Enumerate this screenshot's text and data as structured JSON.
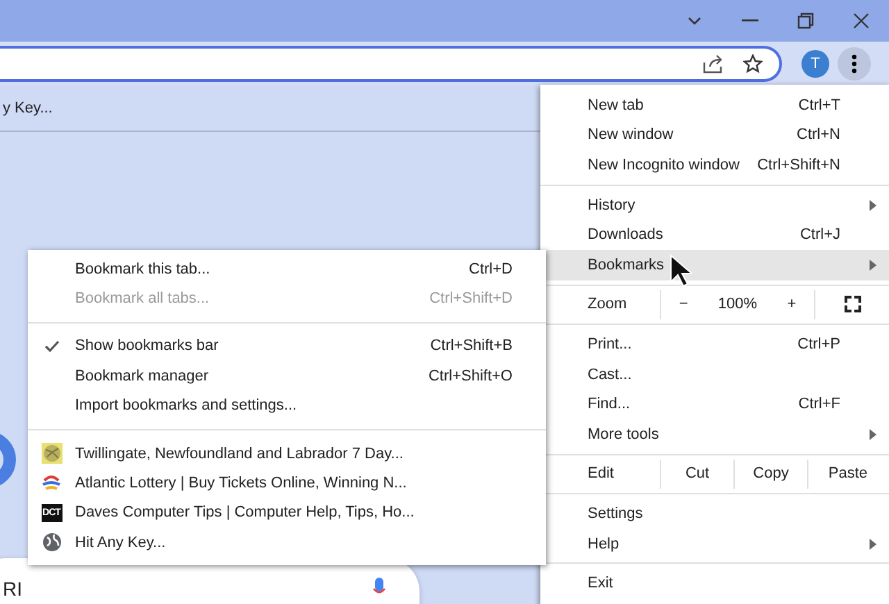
{
  "bookmarks_bar": {
    "item": "y Key..."
  },
  "avatar": {
    "letter": "T"
  },
  "search_box": {
    "text": "RI"
  },
  "menu": {
    "items": [
      {
        "kind": "item",
        "label": "New tab",
        "shortcut": "Ctrl+T",
        "submenu": false,
        "selected": false
      },
      {
        "kind": "item",
        "label": "New window",
        "shortcut": "Ctrl+N",
        "submenu": false,
        "selected": false
      },
      {
        "kind": "item",
        "label": "New Incognito window",
        "shortcut": "Ctrl+Shift+N",
        "submenu": false,
        "selected": false
      },
      {
        "kind": "divider"
      },
      {
        "kind": "item",
        "label": "History",
        "submenu": true,
        "selected": false
      },
      {
        "kind": "item",
        "label": "Downloads",
        "shortcut": "Ctrl+J",
        "submenu": false,
        "selected": false
      },
      {
        "kind": "item",
        "label": "Bookmarks",
        "submenu": true,
        "selected": true
      },
      {
        "kind": "divider"
      },
      {
        "kind": "zoom",
        "label": "Zoom",
        "minus": "−",
        "value": "100%",
        "plus": "+"
      },
      {
        "kind": "divider"
      },
      {
        "kind": "item",
        "label": "Print...",
        "shortcut": "Ctrl+P",
        "submenu": false,
        "selected": false
      },
      {
        "kind": "item",
        "label": "Cast...",
        "submenu": false,
        "selected": false
      },
      {
        "kind": "item",
        "label": "Find...",
        "shortcut": "Ctrl+F",
        "submenu": false,
        "selected": false
      },
      {
        "kind": "item",
        "label": "More tools",
        "submenu": true,
        "selected": false
      },
      {
        "kind": "divider"
      },
      {
        "kind": "edit",
        "label": "Edit",
        "buttons": [
          "Cut",
          "Copy",
          "Paste"
        ]
      },
      {
        "kind": "divider"
      },
      {
        "kind": "item",
        "label": "Settings",
        "submenu": false,
        "selected": false
      },
      {
        "kind": "item",
        "label": "Help",
        "submenu": true,
        "selected": false
      },
      {
        "kind": "divider"
      },
      {
        "kind": "item",
        "label": "Exit",
        "submenu": false,
        "selected": false
      }
    ]
  },
  "bookmarks_menu": {
    "items": [
      {
        "kind": "item",
        "label": "Bookmark this tab...",
        "shortcut": "Ctrl+D",
        "disabled": false,
        "checked": false
      },
      {
        "kind": "item",
        "label": "Bookmark all tabs...",
        "shortcut": "Ctrl+Shift+D",
        "disabled": true,
        "checked": false
      },
      {
        "kind": "divider"
      },
      {
        "kind": "item",
        "label": "Show bookmarks bar",
        "shortcut": "Ctrl+Shift+B",
        "disabled": false,
        "checked": true
      },
      {
        "kind": "item",
        "label": "Bookmark manager",
        "shortcut": "Ctrl+Shift+O",
        "disabled": false,
        "checked": false
      },
      {
        "kind": "item",
        "label": "Import bookmarks and settings...",
        "disabled": false,
        "checked": false
      },
      {
        "kind": "divider"
      },
      {
        "kind": "bookmark",
        "label": "Twillingate, Newfoundland and Labrador 7 Day...",
        "favicon": {
          "kind": "ball"
        }
      },
      {
        "kind": "bookmark",
        "label": "Atlantic Lottery | Buy Tickets Online, Winning N...",
        "favicon": {
          "kind": "stripes"
        }
      },
      {
        "kind": "bookmark",
        "label": "Daves Computer Tips | Computer Help, Tips, Ho...",
        "favicon": {
          "kind": "badge",
          "text": "DCT"
        }
      },
      {
        "kind": "bookmark",
        "label": "Hit Any Key...",
        "favicon": {
          "kind": "globe"
        }
      }
    ]
  }
}
